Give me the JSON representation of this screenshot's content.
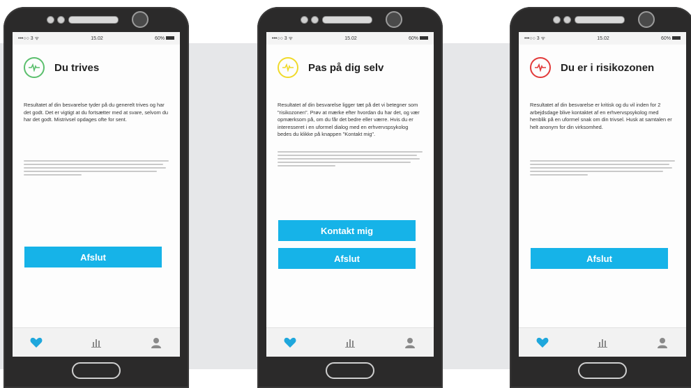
{
  "colors": {
    "green": "#5bbf6d",
    "yellow": "#f0da2b",
    "red": "#e23a3a",
    "button": "#16b3e8",
    "tab_active": "#1fa7dc",
    "tab_inactive": "#8a8a8a"
  },
  "phones": [
    {
      "status": {
        "carrier": "•••○○ 3 ᯤ",
        "time": "15.02",
        "battery": "60%"
      },
      "icon": "heartbeat-icon",
      "accent": "green",
      "title": "Du trives",
      "body": "Resultatet af din besvarelse tyder på du generelt trives og har det godt. Det er vigtigt at du fortsætter med at svare, selvom du har det godt. Mistrivsel opdages ofte for sent.",
      "primary_button": null,
      "exit_button": "Afslut"
    },
    {
      "status": {
        "carrier": "•••○○ 3 ᯤ",
        "time": "15.02",
        "battery": "60%"
      },
      "icon": "heartbeat-icon",
      "accent": "yellow",
      "title": "Pas på dig selv",
      "body": "Resultatet af din besvarelse ligger tæt på det vi betegner som \"risikozonen\". Prøv at mærke efter hvordan du har det, og vær opmærksom på, om du får det bedre eller værre. Hvis du er interesseret i en uformel dialog med en erhvervspsykolog bedes du klikke på knappen \"Kontakt mig\".",
      "primary_button": "Kontakt mig",
      "exit_button": "Afslut"
    },
    {
      "status": {
        "carrier": "•••○○ 3 ᯤ",
        "time": "15.02",
        "battery": "60%"
      },
      "icon": "heartbeat-icon",
      "accent": "red",
      "title": "Du er i risikozonen",
      "body": "Resultatet af din besvarelse er kritisk og du vil inden for 2 arbejdsdage blive kontaktet af en erhvervspsykolog med henblik på en uformel snak om din trivsel. Husk at samtalen er helt anonym for din virksomhed.",
      "primary_button": null,
      "exit_button": "Afslut"
    }
  ],
  "tabs": [
    "heart-icon",
    "bar-chart-icon",
    "profile-icon"
  ]
}
